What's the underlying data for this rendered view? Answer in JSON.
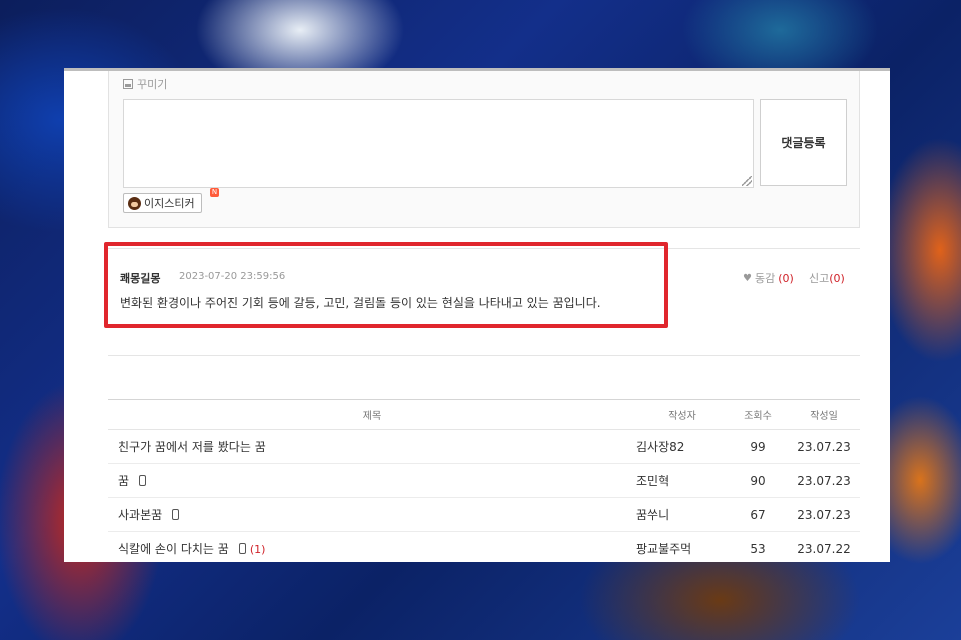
{
  "editor": {
    "decor_label": "꾸미기",
    "textarea_value": "",
    "submit_label": "댓글등록",
    "sticker_label": "이지스티커",
    "sticker_badge": "N"
  },
  "comment": {
    "author": "쾌몽길몽",
    "date": "2023-07-20 23:59:56",
    "body": "변화된 환경이나 주어진 기회 등에 갈등, 고민, 걸림돌 등이 있는 현실을 나타내고 있는 꿈입니다.",
    "like_label": "동감",
    "like_count": "(0)",
    "report_label": "신고",
    "report_count": "(0)"
  },
  "table": {
    "headers": {
      "title": "제목",
      "author": "작성자",
      "views": "조회수",
      "date": "작성일"
    },
    "rows": [
      {
        "title": "친구가 꿈에서 저를 봤다는 꿈",
        "mobile": false,
        "replies": "",
        "author": "김사장82",
        "views": "99",
        "date": "23.07.23"
      },
      {
        "title": "꿈",
        "mobile": true,
        "replies": "",
        "author": "조민혁",
        "views": "90",
        "date": "23.07.23"
      },
      {
        "title": "사과본꿈",
        "mobile": true,
        "replies": "",
        "author": "꿈쑤니",
        "views": "67",
        "date": "23.07.23"
      },
      {
        "title": "식칼에 손이 다치는 꿈",
        "mobile": true,
        "replies": "(1)",
        "author": "팡교불주먹",
        "views": "53",
        "date": "23.07.22"
      }
    ]
  },
  "colors": {
    "accent_red": "#e0262d",
    "count_red": "#d0232a"
  },
  "icons": [
    "image-icon",
    "sticker-face-icon",
    "heart-icon",
    "mobile-icon",
    "resize-grip-icon"
  ]
}
